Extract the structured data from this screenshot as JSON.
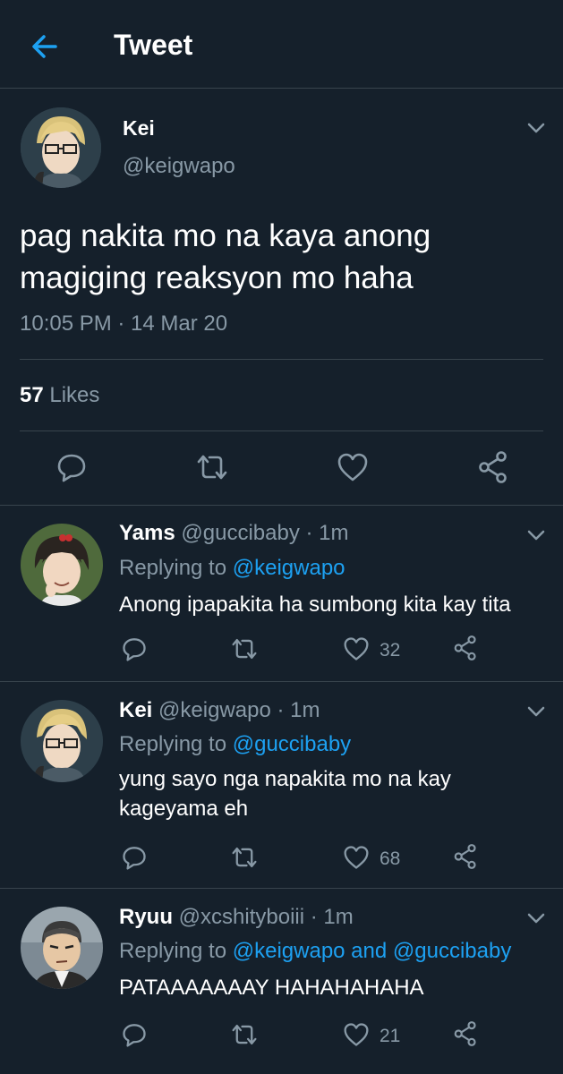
{
  "header": {
    "title": "Tweet"
  },
  "tweet": {
    "name": "Kei",
    "handle": "@keigwapo",
    "text_line1": "pag nakita mo na kaya anong",
    "text_line2": "magiging reaksyon mo haha",
    "time": "10:05 PM · 14 Mar 20",
    "likes_count": "57",
    "likes_label": "Likes"
  },
  "replies": [
    {
      "name": "Yams",
      "meta": "@guccibaby · 1m",
      "replying_prefix": "Replying to ",
      "replying_to": "@keigwapo",
      "text": "Anong ipapakita ha sumbong kita kay tita",
      "like_count": "32"
    },
    {
      "name": "Kei",
      "meta": "@keigwapo · 1m",
      "replying_prefix": "Replying to ",
      "replying_to": "@guccibaby",
      "text_line1": "yung sayo nga napakita mo na kay",
      "text_line2": "kageyama eh",
      "like_count": "68"
    },
    {
      "name": "Ryuu",
      "meta": "@xcshityboiii · 1m",
      "replying_prefix": "Replying to ",
      "replying_to": "@keigwapo and @guccibaby",
      "text": "PATAAAAAAAY HAHAHAHAHA",
      "like_count": "21"
    }
  ],
  "icons": {
    "back": "arrow-left-icon",
    "reply": "comment-icon",
    "retweet": "retweet-icon",
    "like": "heart-icon",
    "share": "share-icon",
    "more": "chevron-down-icon"
  },
  "colors": {
    "background": "#15202b",
    "accent": "#1da1f2",
    "secondary_text": "#8899a6",
    "divider": "#38444d"
  }
}
